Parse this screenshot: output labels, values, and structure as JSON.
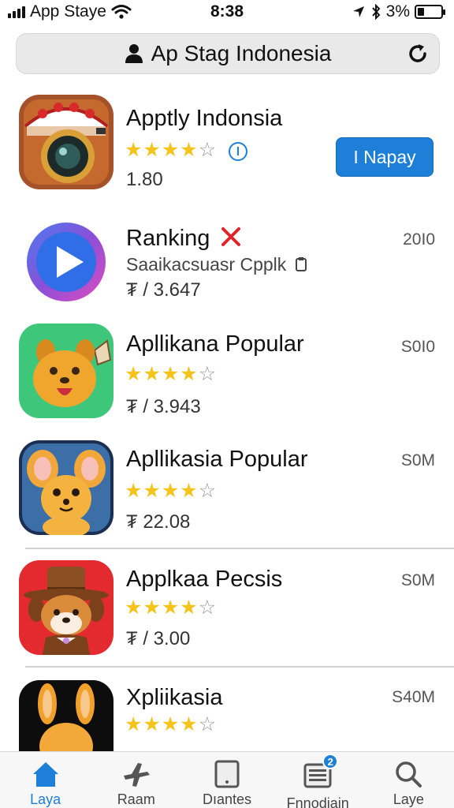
{
  "status_bar": {
    "carrier": "App Staye",
    "time": "8:38",
    "battery_percent": "3%",
    "battery_level": 0.3
  },
  "address_bar": {
    "title": "Ap Stag Indonesia",
    "icons": [
      "person-icon",
      "reload-icon"
    ]
  },
  "apps": [
    {
      "name": "Apptly Indonsia",
      "rating_stars": 4,
      "price": "1.80",
      "button_label": "I Napay",
      "info_badge": "l",
      "icon": "camera-app-icon",
      "colors": {
        "button": "#1d7fd8"
      }
    },
    {
      "name": "Ranking",
      "subtitle": "Saaikacsuasr Cpplk",
      "price": "₮ / 3.647",
      "size": "20I0",
      "icon": "play-app-icon"
    },
    {
      "name": "Apllikana Popular",
      "rating_stars": 4,
      "price": "₮ / 3.943",
      "size": "S0I0",
      "icon": "dog-app-icon"
    },
    {
      "name": "Apllikasia Popular",
      "rating_stars": 4,
      "price": "₮ 22.08",
      "size": "S0M",
      "icon": "mouse-app-icon"
    },
    {
      "name": "Applkaa Pecsis",
      "rating_stars": 4,
      "price": "₮ / 3.00",
      "size": "S0M",
      "icon": "hat-dog-app-icon"
    },
    {
      "name": "Xpliikasia",
      "rating_stars": 4,
      "size": "S40M",
      "icon": "bunny-app-icon"
    }
  ],
  "tab_bar": {
    "tabs": [
      {
        "label": "Laya",
        "icon": "home-icon",
        "active": true
      },
      {
        "label": "Raam",
        "icon": "plane-icon",
        "active": false
      },
      {
        "label": "Dıantes",
        "icon": "tablet-icon",
        "active": false
      },
      {
        "label": "Fnnodiain",
        "icon": "updates-icon",
        "active": false,
        "badge": "2"
      },
      {
        "label": "Laye",
        "icon": "search-icon",
        "active": false
      }
    ]
  },
  "colors": {
    "accent": "#1d7fd8",
    "star": "#f6c31a",
    "close_x": "#e0242b"
  }
}
